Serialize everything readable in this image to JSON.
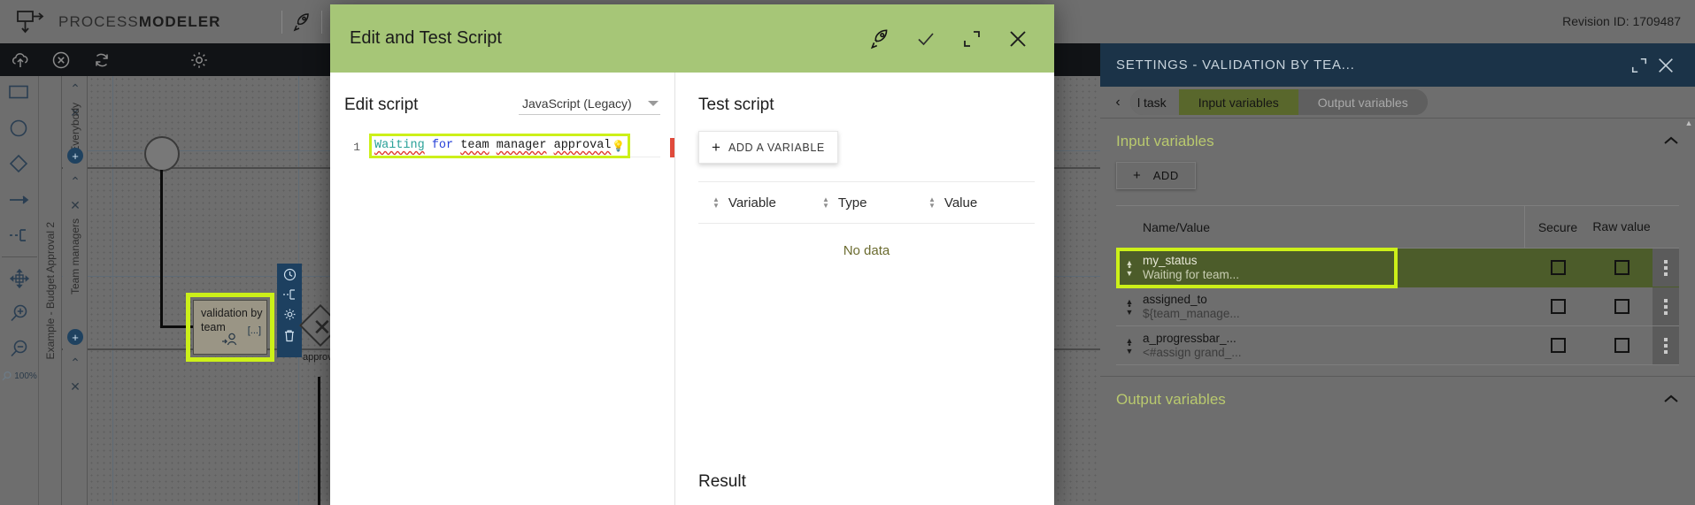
{
  "topbar": {
    "brand_first": "PROCESS",
    "brand_second": "MODELER",
    "revision": "Revision ID: 1709487",
    "icons": [
      "rocket-icon",
      "table-icon",
      "bulb-icon",
      "pdf-icon"
    ]
  },
  "toolbar_dark": {
    "icons": [
      "cloud-upload-icon",
      "cancel-circle-icon",
      "refresh-icon",
      "gear-icon"
    ]
  },
  "palette": {
    "items": [
      "rectangle-shape",
      "circle-shape",
      "diamond-shape",
      "arrow-connector",
      "boundary-connector",
      "pan-tool",
      "zoom-in",
      "zoom-out"
    ],
    "zoom_level": "100%"
  },
  "canvas": {
    "pool_label": "Example - Budget Approval 2",
    "lanes": [
      "Everybody",
      "Team managers"
    ],
    "task_label": "validation by team",
    "task_ellipsis": "[...]",
    "flow_label": "approv",
    "context_icons": [
      "timer-icon",
      "boundary-icon",
      "gear-icon",
      "trash-icon"
    ]
  },
  "modal": {
    "title": "Edit and Test Script",
    "header_icons": [
      "rocket-icon",
      "check-icon",
      "expand-icon",
      "close-icon"
    ],
    "left": {
      "title": "Edit script",
      "language": "JavaScript (Legacy)",
      "line_number": "1",
      "code_tokens": [
        {
          "text": "Waiting",
          "cls": "c-str"
        },
        {
          "text": " ",
          "cls": "c-plain"
        },
        {
          "text": "for",
          "cls": "c-kw"
        },
        {
          "text": " ",
          "cls": "c-plain"
        },
        {
          "text": "team",
          "cls": "c-id"
        },
        {
          "text": " ",
          "cls": "c-plain"
        },
        {
          "text": "manager",
          "cls": "c-id"
        },
        {
          "text": " ",
          "cls": "c-plain"
        },
        {
          "text": "approval",
          "cls": "c-id"
        }
      ],
      "bulb": "💡"
    },
    "right": {
      "title": "Test script",
      "add_variable_label": "ADD A VARIABLE",
      "columns": [
        "Variable",
        "Type",
        "Value"
      ],
      "empty_text": "No data",
      "result_title": "Result"
    }
  },
  "settings": {
    "title": "SETTINGS  -  VALIDATION BY TEA...",
    "header_icons": [
      "expand-icon",
      "close-icon"
    ],
    "tabs": [
      {
        "label": "l task",
        "state": "clipped"
      },
      {
        "label": "Input variables",
        "state": "active"
      },
      {
        "label": "Output variables",
        "state": "muted"
      }
    ],
    "input_section": {
      "title": "Input variables",
      "add_label": "ADD",
      "columns": [
        "Name/Value",
        "Secure",
        "Raw value"
      ],
      "rows": [
        {
          "name": "my_status",
          "value": "Waiting for team...",
          "selected": true
        },
        {
          "name": "assigned_to",
          "value": "${team_manage...",
          "selected": false
        },
        {
          "name": "a_progressbar_...",
          "value": "<#assign grand_...",
          "selected": false
        }
      ]
    },
    "output_section": {
      "title": "Output variables"
    }
  },
  "colors": {
    "modal_header": "#a6c677",
    "highlight": "#ccf019",
    "settings_header": "#1b3348",
    "selected_row": "#4c5c2a",
    "accent_green": "#b9c96e"
  }
}
